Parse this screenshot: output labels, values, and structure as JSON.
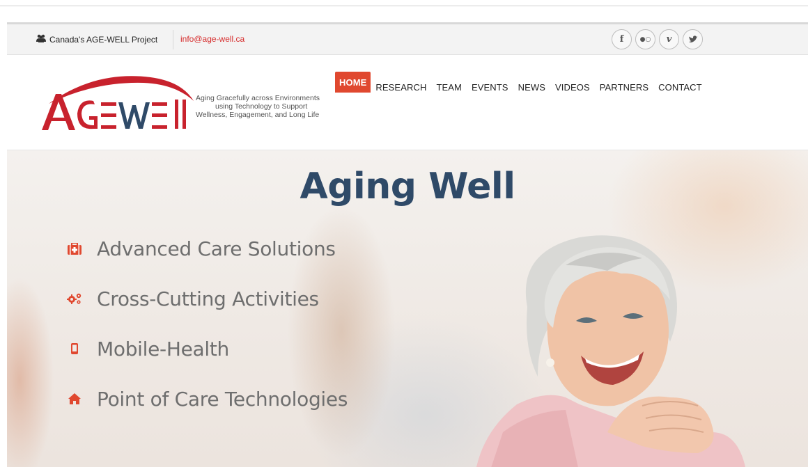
{
  "topbar": {
    "project_label": "Canada's AGE-WELL Project",
    "email": "info@age-well.ca",
    "socials": [
      {
        "icon": "facebook-icon",
        "glyph": "f"
      },
      {
        "icon": "flickr-icon",
        "glyph": "●○"
      },
      {
        "icon": "vimeo-icon",
        "glyph": "v"
      },
      {
        "icon": "twitter-icon",
        "glyph": "✦"
      }
    ]
  },
  "logo": {
    "wordmark": "AGE-WELL",
    "tagline_line1": "Aging Gracefully across Environments",
    "tagline_line2": "using Technology to Support",
    "tagline_line3": "Wellness, Engagement, and Long Life",
    "accent_color": "#c8222d"
  },
  "nav": {
    "items": [
      {
        "label": "HOME",
        "active": true
      },
      {
        "label": "RESEARCH",
        "active": false
      },
      {
        "label": "TEAM",
        "active": false
      },
      {
        "label": "EVENTS",
        "active": false
      },
      {
        "label": "NEWS",
        "active": false
      },
      {
        "label": "VIDEOS",
        "active": false
      },
      {
        "label": "PARTNERS",
        "active": false
      },
      {
        "label": "CONTACT",
        "active": false
      }
    ],
    "active_color": "#e0482f"
  },
  "hero": {
    "title": "Aging Well",
    "title_color": "#2f4a68",
    "icon_color": "#e0482f",
    "features": [
      {
        "label": "Advanced Care Solutions",
        "icon": "medkit-icon"
      },
      {
        "label": "Cross-Cutting Activities",
        "icon": "gears-icon"
      },
      {
        "label": "Mobile-Health",
        "icon": "mobile-phone-icon"
      },
      {
        "label": "Point of Care Technologies",
        "icon": "home-icon"
      }
    ]
  }
}
